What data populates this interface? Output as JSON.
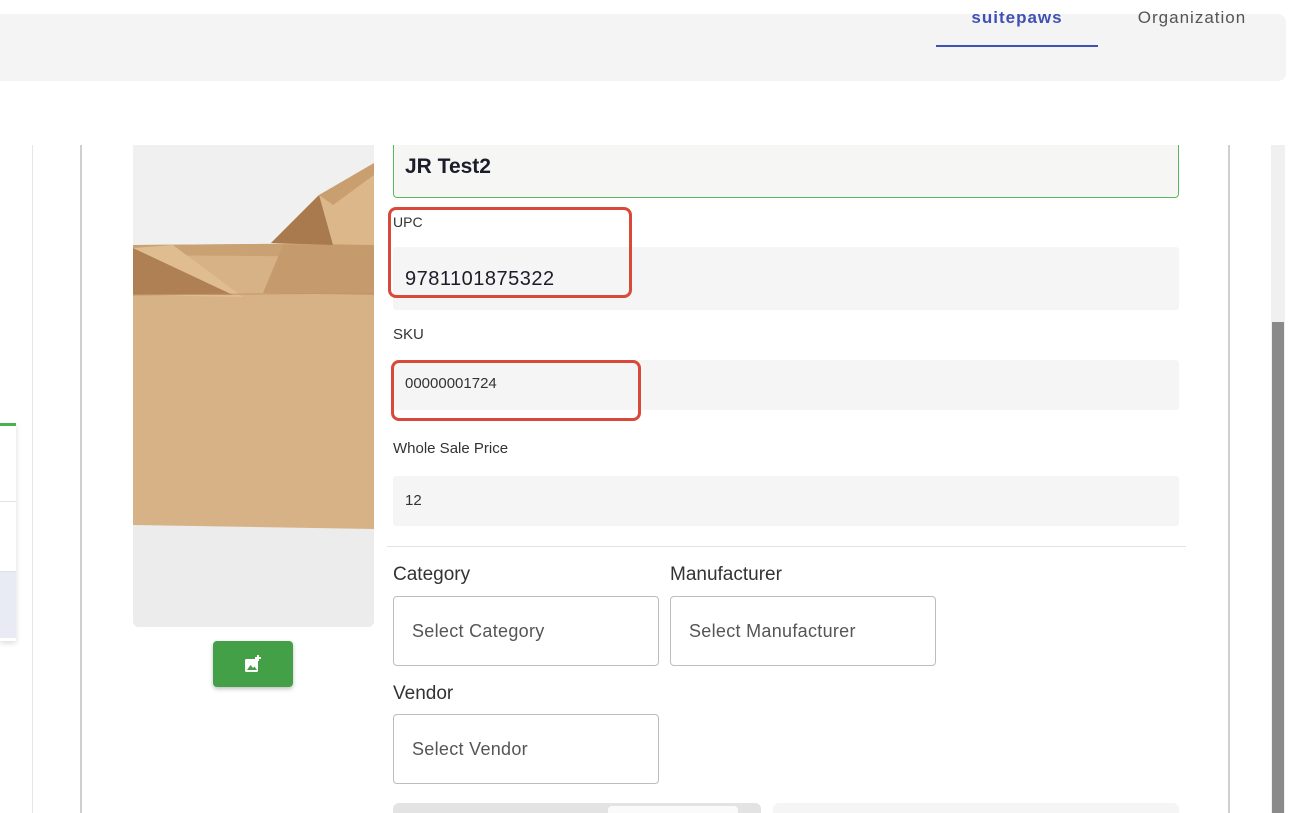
{
  "tabs": [
    {
      "label": "suitepaws",
      "active": true
    },
    {
      "label": "Organization",
      "active": false
    }
  ],
  "product": {
    "name": "JR Test2",
    "upc_label": "UPC",
    "upc_value": "9781101875322",
    "sku_label": "SKU",
    "sku_value": "00000001724",
    "wholesale_label": "Whole Sale Price",
    "wholesale_value": "12"
  },
  "selects": {
    "category": {
      "label": "Category",
      "placeholder": "Select Category"
    },
    "manufacturer": {
      "label": "Manufacturer",
      "placeholder": "Select Manufacturer"
    },
    "vendor": {
      "label": "Vendor",
      "placeholder": "Select Vendor"
    }
  },
  "image_button": {
    "icon": "add-photo-icon"
  },
  "colors": {
    "accent": "#3f51b5",
    "success": "#43a047",
    "highlight": "#d9493a",
    "field_border": "#5cb85c"
  }
}
